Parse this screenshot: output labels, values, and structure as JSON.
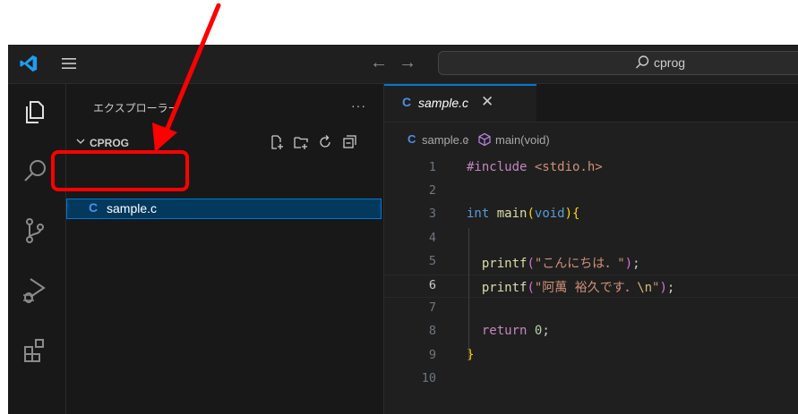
{
  "titlebar": {
    "logo_icon": "vscode-logo-icon",
    "menu_icon": "hamburger-menu-icon",
    "back_icon": "arrow-left-icon",
    "back_glyph": "←",
    "forward_icon": "arrow-right-icon",
    "forward_glyph": "→",
    "search_icon": "search-icon",
    "search_text": "cprog"
  },
  "activity_bar": {
    "items": [
      {
        "name": "explorer",
        "icon": "files-icon"
      },
      {
        "name": "search",
        "icon": "search-icon"
      },
      {
        "name": "source-control",
        "icon": "source-control-icon"
      },
      {
        "name": "run-debug",
        "icon": "run-debug-icon"
      },
      {
        "name": "extensions",
        "icon": "extensions-icon"
      }
    ]
  },
  "sidebar": {
    "title": "エクスプローラー",
    "more": "···",
    "project": "CPROG",
    "tools": [
      "new-file-icon",
      "new-folder-icon",
      "refresh-icon",
      "collapse-all-icon"
    ],
    "files": [
      {
        "icon": "C",
        "name": "sample.c"
      }
    ]
  },
  "tabs": [
    {
      "icon": "C",
      "name": "sample.c",
      "close": "✕"
    }
  ],
  "breadcrumb": {
    "icon": "C",
    "file": "sample.c",
    "separator": "›",
    "symbol_icon": "method-icon",
    "function": "main(void)"
  },
  "editor": {
    "active_line": 6,
    "lines": [
      {
        "n": "1",
        "segments": [
          {
            "t": "#include ",
            "c": "#c586c0"
          },
          {
            "t": "<stdio.h>",
            "c": "#ce9178"
          }
        ]
      },
      {
        "n": "2",
        "segments": []
      },
      {
        "n": "3",
        "segments": [
          {
            "t": "int",
            "c": "#569cd6"
          },
          {
            "t": " ",
            "c": "#cccccc"
          },
          {
            "t": "main",
            "c": "#dcdcaa"
          },
          {
            "t": "(",
            "c": "#ffd700"
          },
          {
            "t": "void",
            "c": "#569cd6"
          },
          {
            "t": ")",
            "c": "#ffd700"
          },
          {
            "t": "{",
            "c": "#ffd700"
          }
        ]
      },
      {
        "n": "4",
        "segments": []
      },
      {
        "n": "5",
        "segments": [
          {
            "t": "  ",
            "c": "#cccccc"
          },
          {
            "t": "printf",
            "c": "#dcdcaa"
          },
          {
            "t": "(",
            "c": "#da70d6"
          },
          {
            "t": "\"こんにちは．\"",
            "c": "#ce9178"
          },
          {
            "t": ")",
            "c": "#da70d6"
          },
          {
            "t": ";",
            "c": "#cccccc"
          }
        ]
      },
      {
        "n": "6",
        "segments": [
          {
            "t": "  ",
            "c": "#cccccc"
          },
          {
            "t": "printf",
            "c": "#dcdcaa"
          },
          {
            "t": "(",
            "c": "#da70d6"
          },
          {
            "t": "\"阿萬 裕久です．",
            "c": "#ce9178"
          },
          {
            "t": "\\n",
            "c": "#d7ba7d"
          },
          {
            "t": "\"",
            "c": "#ce9178"
          },
          {
            "t": ")",
            "c": "#da70d6"
          },
          {
            "t": ";",
            "c": "#cccccc"
          }
        ]
      },
      {
        "n": "7",
        "segments": []
      },
      {
        "n": "8",
        "segments": [
          {
            "t": "  ",
            "c": "#cccccc"
          },
          {
            "t": "return",
            "c": "#c586c0"
          },
          {
            "t": " ",
            "c": "#cccccc"
          },
          {
            "t": "0",
            "c": "#b5cea8"
          },
          {
            "t": ";",
            "c": "#cccccc"
          }
        ]
      },
      {
        "n": "9",
        "segments": [
          {
            "t": "}",
            "c": "#ffd700"
          }
        ]
      },
      {
        "n": "10",
        "segments": []
      }
    ]
  },
  "annotation": {
    "arrow_icon": "red-arrow-annotation",
    "highlight": "red-highlight-box",
    "color": "#ff0000"
  }
}
